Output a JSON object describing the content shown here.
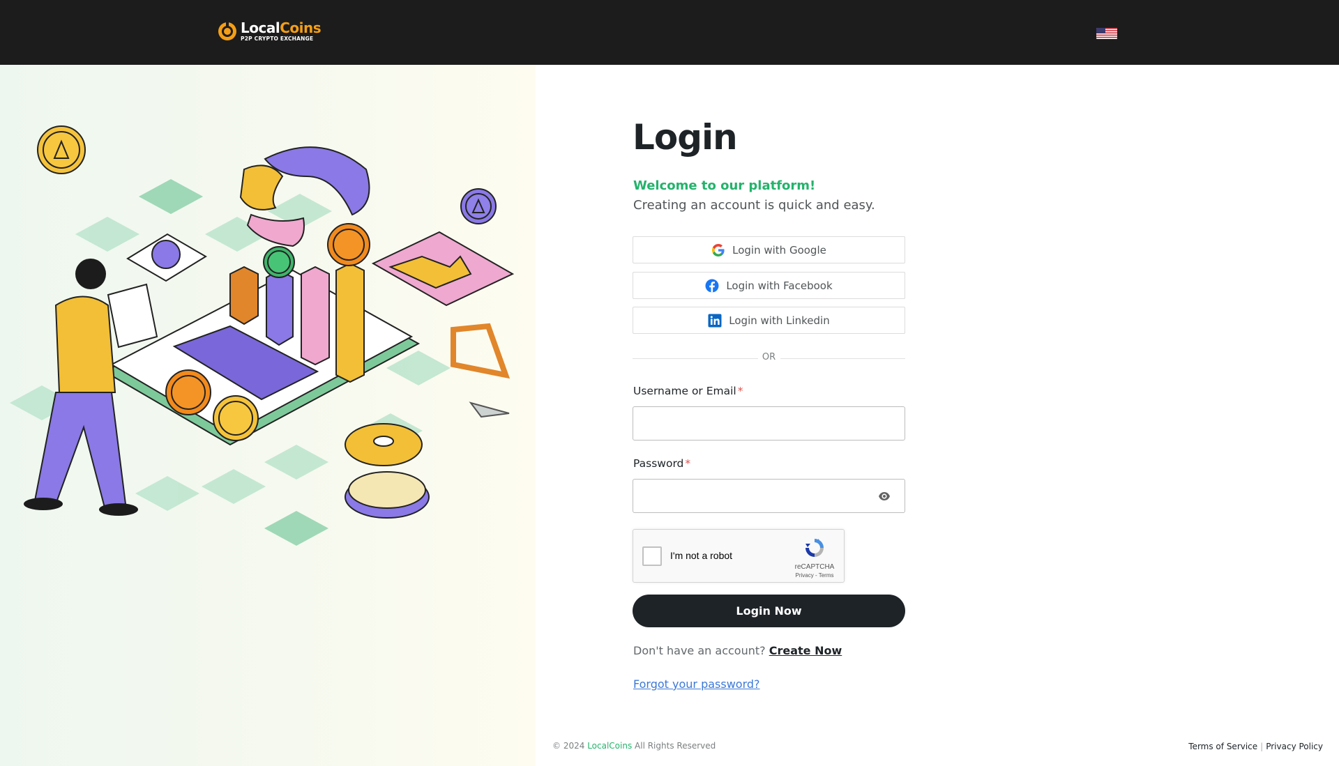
{
  "header": {
    "brand_primary": "Local",
    "brand_secondary": "Coins",
    "brand_tagline": "P2P CRYPTO EXCHANGE",
    "language_flag": "us-flag-icon"
  },
  "login": {
    "title": "Login",
    "welcome": "Welcome to our platform!",
    "subtitle": "Creating an account is quick and easy.",
    "social": {
      "google_label": "Login with Google",
      "facebook_label": "Login with Facebook",
      "linkedin_label": "Login with Linkedin"
    },
    "divider_text": "OR",
    "username_label": "Username or Email",
    "username_value": "",
    "password_label": "Password",
    "password_value": "",
    "required_mark": "*",
    "captcha": {
      "text": "I'm not a robot",
      "brand": "reCAPTCHA",
      "links": "Privacy - Terms"
    },
    "submit_label": "Login Now",
    "signup_prompt": "Don't have an account?",
    "signup_link": "Create Now",
    "forgot_link": "Forgot your password?"
  },
  "footer": {
    "copyright_prefix": "© 2024",
    "copyright_brand": "LocalCoins",
    "copyright_suffix": "All Rights Reserved",
    "terms": "Terms of Service",
    "separator": "|",
    "privacy": "Privacy Policy"
  },
  "colors": {
    "accent_green": "#23b36b",
    "brand_orange": "#f59f16",
    "dark": "#1d2327",
    "link_blue": "#3b78d8"
  }
}
